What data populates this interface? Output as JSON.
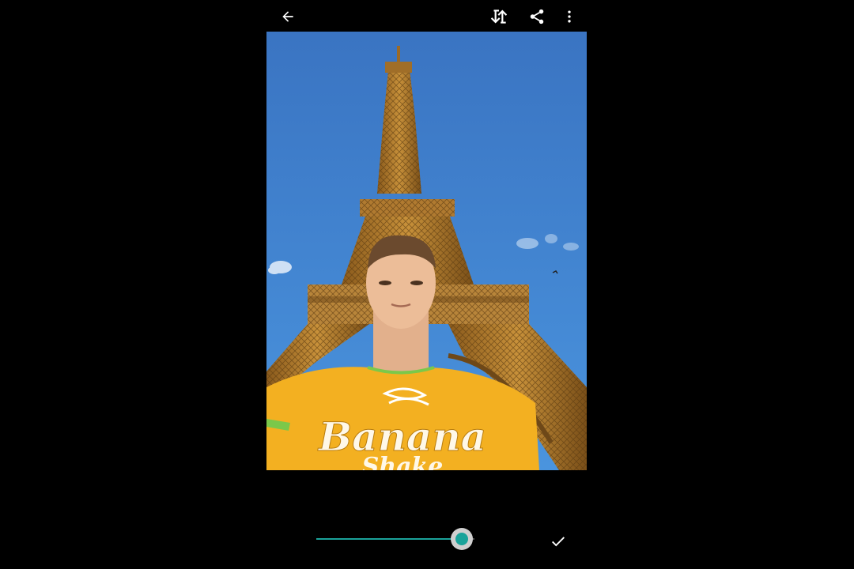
{
  "toolbar": {
    "icons": [
      "back-arrow-icon",
      "compare-icon",
      "share-icon",
      "more-vert-icon"
    ]
  },
  "photo": {
    "shirt_text": "Banana",
    "shirt_text_2": "Shake"
  },
  "adjustment": {
    "level": 0.92,
    "accent_color": "#1aa39a"
  },
  "colors": {
    "background": "#000000",
    "sky": "#3b7dc7",
    "accent": "#1aa39a"
  }
}
